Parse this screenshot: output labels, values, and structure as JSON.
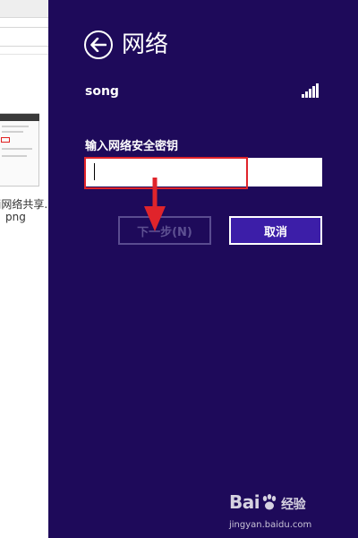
{
  "background_window": {
    "caption_line1": "j网络共享.",
    "caption_line2": "png"
  },
  "network_panel": {
    "back_icon": "arrow-left-circle-icon",
    "title": "网络",
    "ssid": "song",
    "signal_icon": "wifi-signal-bars-icon",
    "signal_bars": 5,
    "key_label": "输入网络安全密钥",
    "key_value": "",
    "next_label": "下一步(N)",
    "next_enabled": false,
    "cancel_label": "取消"
  },
  "annotation": {
    "highlight_color": "#e0242b",
    "arrow_icon": "red-down-arrow-icon"
  },
  "watermark": {
    "logo_text_1": "Bai",
    "logo_text_2": "经验",
    "url": "jingyan.baidu.com"
  },
  "colors": {
    "panel_background": "#1e0a5a",
    "cancel_button": "#3c1ea8",
    "disabled_text": "#5e5192"
  }
}
